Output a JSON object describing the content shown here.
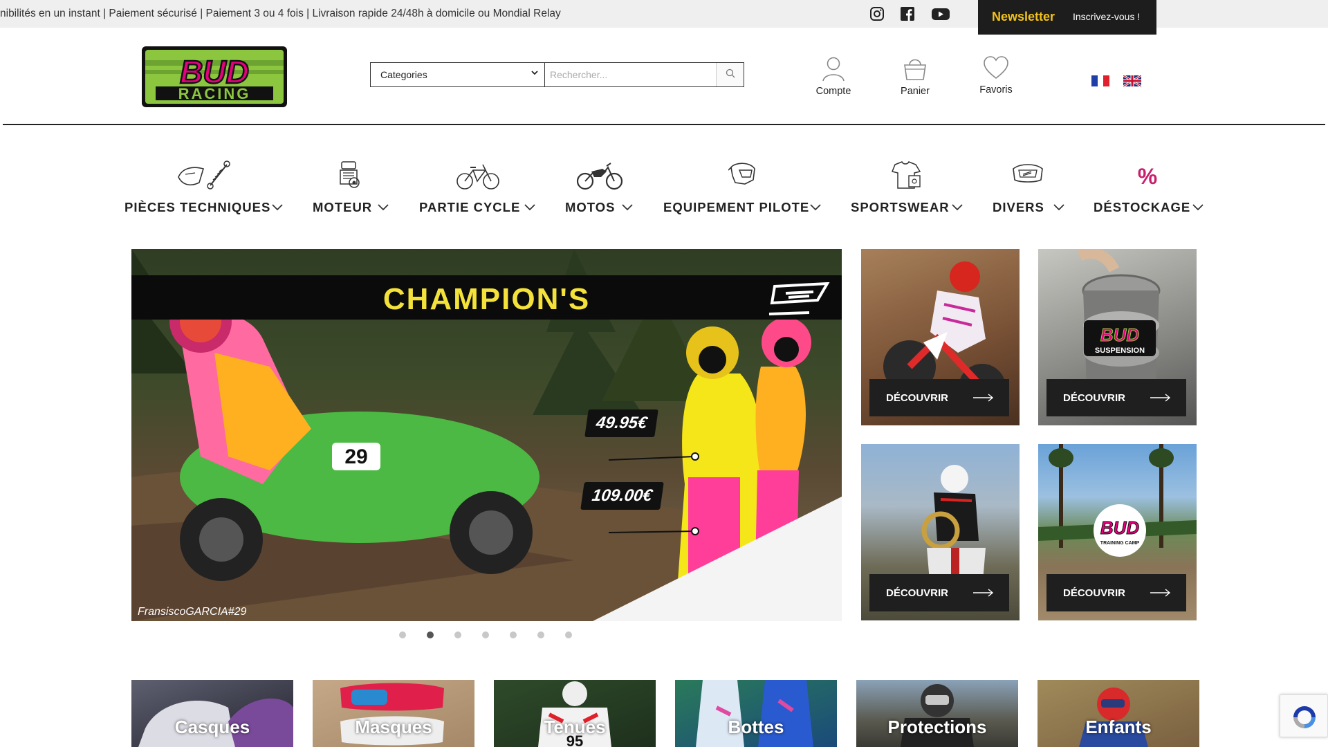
{
  "topbar": {
    "ticker": "nibilités en un instant | Paiement sécurisé | Paiement 3 ou 4 fois | Livraison rapide 24/48h à domicile ou Mondial Relay",
    "newsletter_title": "Newsletter",
    "newsletter_sub": "Inscrivez-vous !",
    "social_icons": [
      "instagram-icon",
      "facebook-icon",
      "youtube-icon"
    ]
  },
  "header": {
    "logo_top": "BUD",
    "logo_bottom": "RACING",
    "search_category": "Categories",
    "search_placeholder": "Rechercher...",
    "account_label": "Compte",
    "cart_label": "Panier",
    "favorites_label": "Favoris",
    "languages": [
      "fr",
      "en"
    ]
  },
  "nav": {
    "items": [
      {
        "label": "PIÈCES TECHNIQUES",
        "icon": "suspension-parts-icon"
      },
      {
        "label": "MOTEUR",
        "icon": "engine-icon"
      },
      {
        "label": "PARTIE CYCLE",
        "icon": "bicycle-icon"
      },
      {
        "label": "MOTOS",
        "icon": "motorcycle-icon"
      },
      {
        "label": "EQUIPEMENT PILOTE",
        "icon": "helmet-icon"
      },
      {
        "label": "SPORTSWEAR",
        "icon": "tshirt-icon"
      },
      {
        "label": "DIVERS",
        "icon": "goggles-icon"
      },
      {
        "label": "DÉSTOCKAGE",
        "icon": "percent-icon"
      }
    ]
  },
  "hero": {
    "title": "CHAMPION'S",
    "price_1": "49.95€",
    "price_2": "109.00€",
    "credit": "FransiscoGARCIA#29",
    "slides_count": 7,
    "active_slide": 2
  },
  "tiles": {
    "button_label": "DÉCOUVRIR",
    "badge_suspension": "SUSPENSION",
    "badge_camp": "TRAINING CAMP"
  },
  "categories": [
    "Casques",
    "Masques",
    "Tenues",
    "Bottes",
    "Protections",
    "Enfants"
  ],
  "colors": {
    "accent_yellow": "#f2c21a",
    "logo_green": "#8cc63f",
    "logo_pink": "#e6007e",
    "dark": "#1f1f1f"
  }
}
